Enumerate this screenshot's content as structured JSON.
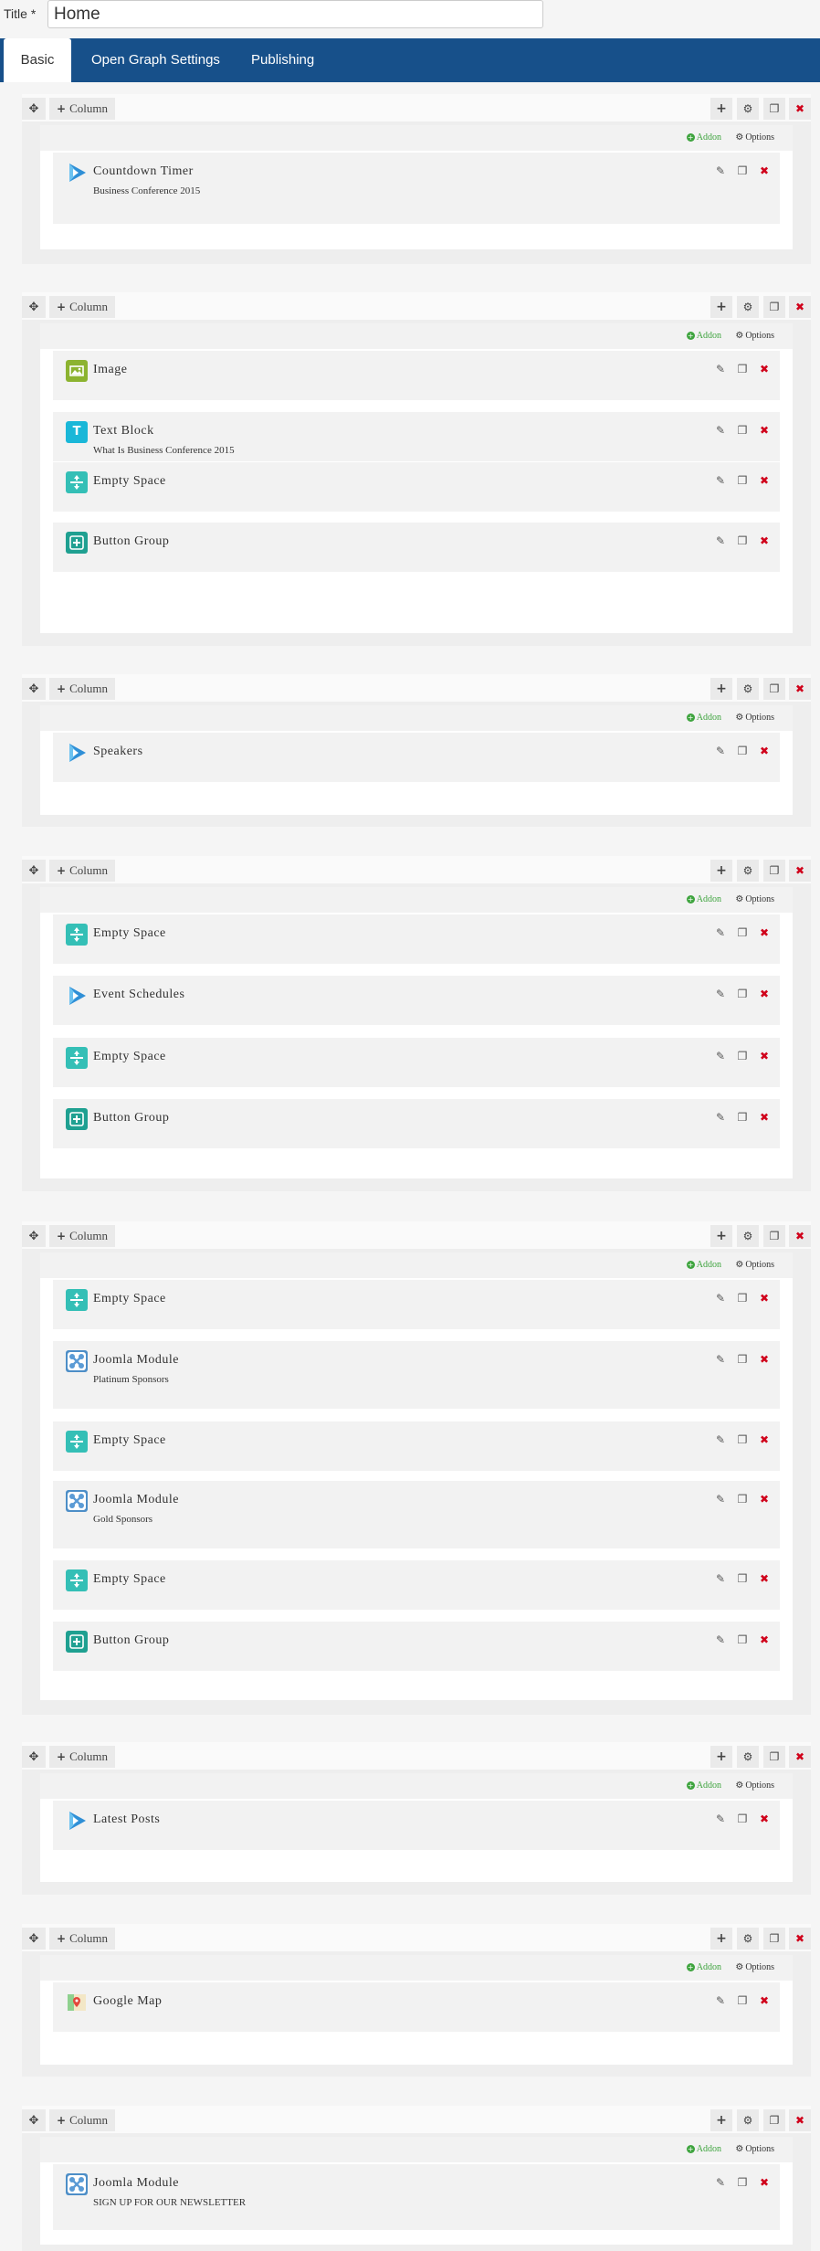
{
  "title": {
    "label": "Title *",
    "value": "Home"
  },
  "tabs": [
    {
      "label": "Basic",
      "active": true
    },
    {
      "label": "Open Graph Settings",
      "active": false
    },
    {
      "label": "Publishing",
      "active": false
    }
  ],
  "toolbar": {
    "column_label": "Column",
    "addon_label": "Addon",
    "options_label": "Options"
  },
  "colors": {
    "tabbar": "#17508a",
    "delete": "#d0021b",
    "addon_green": "#3ea43e"
  },
  "sections": [
    {
      "addons": [
        {
          "title": "Countdown Timer",
          "subtitle": "Business Conference 2015",
          "icon": "play-icon"
        }
      ]
    },
    {
      "addons": [
        {
          "title": "Image",
          "subtitle": "",
          "icon": "image-icon"
        },
        {
          "title": "Text Block",
          "subtitle": "What Is Business Conference 2015",
          "icon": "text-icon"
        },
        {
          "title": "Empty Space",
          "subtitle": "",
          "icon": "empty-space-icon"
        },
        {
          "title": "Button Group",
          "subtitle": "",
          "icon": "button-group-icon"
        }
      ]
    },
    {
      "addons": [
        {
          "title": "Speakers",
          "subtitle": "",
          "icon": "play-icon"
        }
      ]
    },
    {
      "addons": [
        {
          "title": "Empty Space",
          "subtitle": "",
          "icon": "empty-space-icon"
        },
        {
          "title": "Event Schedules",
          "subtitle": "",
          "icon": "play-icon"
        },
        {
          "title": "Empty Space",
          "subtitle": "",
          "icon": "empty-space-icon"
        },
        {
          "title": "Button Group",
          "subtitle": "",
          "icon": "button-group-icon"
        }
      ]
    },
    {
      "addons": [
        {
          "title": "Empty Space",
          "subtitle": "",
          "icon": "empty-space-icon"
        },
        {
          "title": "Joomla Module",
          "subtitle": "Platinum Sponsors",
          "icon": "joomla-icon"
        },
        {
          "title": "Empty Space",
          "subtitle": "",
          "icon": "empty-space-icon"
        },
        {
          "title": "Joomla Module",
          "subtitle": "Gold Sponsors",
          "icon": "joomla-icon"
        },
        {
          "title": "Empty Space",
          "subtitle": "",
          "icon": "empty-space-icon"
        },
        {
          "title": "Button Group",
          "subtitle": "",
          "icon": "button-group-icon"
        }
      ]
    },
    {
      "addons": [
        {
          "title": "Latest Posts",
          "subtitle": "",
          "icon": "play-icon"
        }
      ]
    },
    {
      "addons": [
        {
          "title": "Google Map",
          "subtitle": "",
          "icon": "map-icon"
        }
      ]
    },
    {
      "addons": [
        {
          "title": "Joomla Module",
          "subtitle": "SIGN UP FOR OUR NEWSLETTER",
          "icon": "joomla-icon"
        }
      ]
    }
  ]
}
